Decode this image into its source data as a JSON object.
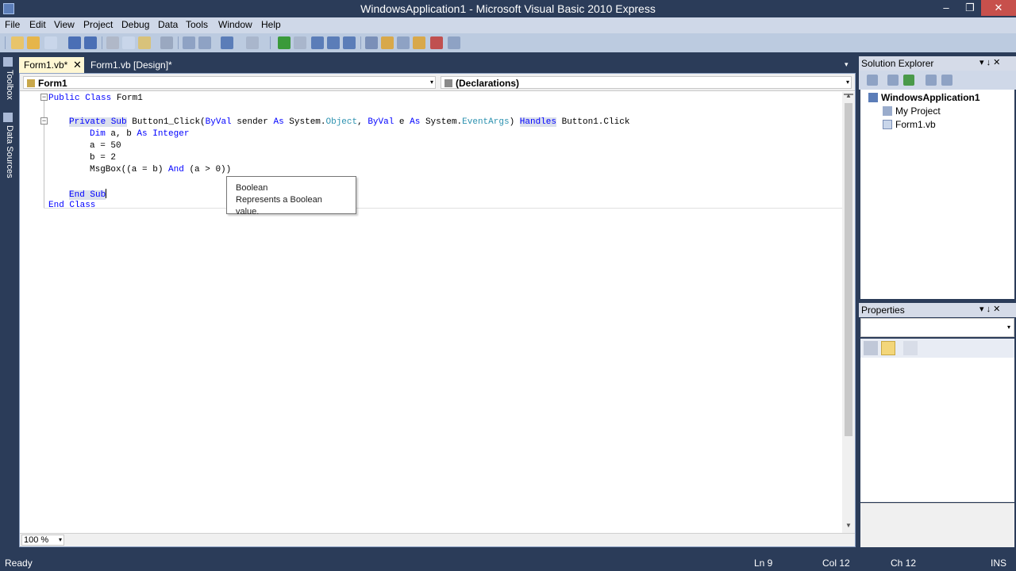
{
  "window": {
    "title": "WindowsApplication1 - Microsoft Visual Basic 2010 Express",
    "minimize_glyph": "–",
    "maximize_glyph": "❐",
    "close_glyph": "✕"
  },
  "menu": [
    "File",
    "Edit",
    "View",
    "Project",
    "Debug",
    "Data",
    "Tools",
    "Window",
    "Help"
  ],
  "left_strip": {
    "toolbox": "Toolbox",
    "data_sources": "Data Sources"
  },
  "doc_tabs": [
    {
      "label": "Form1.vb*",
      "active": true,
      "close_glyph": "✕"
    },
    {
      "label": "Form1.vb [Design]*",
      "active": false
    }
  ],
  "nav": {
    "class_combo": "Form1",
    "member_combo": "(Declarations)",
    "arrow": "▾"
  },
  "code_lines": {
    "l1_kw": "Public Class",
    "l1_name": " Form1",
    "l3_kw1": "Private Sub",
    "l3_sig1": " Button1_Click(",
    "l3_byval1": "ByVal",
    "l3_sig2": " sender ",
    "l3_as1": "As",
    "l3_sig3": " System.",
    "l3_obj": "Object",
    "l3_sig4": ", ",
    "l3_byval2": "ByVal",
    "l3_sig5": " e ",
    "l3_as2": "As",
    "l3_sig6": " System.",
    "l3_ea": "EventArgs",
    "l3_sig7": ") ",
    "l3_handles": "Handles",
    "l3_sig8": " Button1.Click",
    "l4_kw": "Dim",
    "l4_mid": " a, b ",
    "l4_as": "As",
    "l4_sp": " ",
    "l4_type": "Integer",
    "l5": "a = 50",
    "l6": "b = 2",
    "l7_a": "MsgBox((a = b) ",
    "l7_and": "And",
    "l7_b": " (a > 0))",
    "l9": "End Sub",
    "l10": "End Class"
  },
  "tooltip": {
    "title": "Boolean",
    "description": "Represents a Boolean value."
  },
  "zoom": {
    "value": "100 %",
    "arrow": "▾"
  },
  "solution_explorer": {
    "title": "Solution Explorer",
    "pin": "▾ ↓ ✕",
    "solution": "WindowsApplication1",
    "items": [
      "My Project",
      "Form1.vb"
    ]
  },
  "properties": {
    "title": "Properties",
    "pin": "▾ ↓ ✕",
    "combo_arrow": "▾"
  },
  "status": {
    "ready": "Ready",
    "ln": "Ln 9",
    "col": "Col 12",
    "ch": "Ch 12",
    "mode": "INS"
  },
  "colors": {
    "chrome": "#2b3c59",
    "keyword": "#0000ff",
    "type": "#2b91af",
    "active_tab": "#fff7d3"
  }
}
